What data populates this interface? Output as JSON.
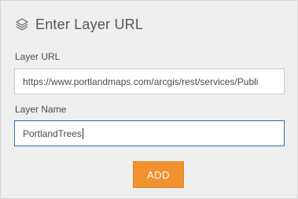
{
  "header": {
    "title": "Enter Layer URL",
    "icon": "layers-icon"
  },
  "form": {
    "url_label": "Layer URL",
    "url_value": "https://www.portlandmaps.com/arcgis/rest/services/Publi",
    "name_label": "Layer Name",
    "name_value": "PortlandTrees"
  },
  "actions": {
    "add_label": "ADD"
  },
  "colors": {
    "accent": "#f0922f",
    "panel_background": "#efefef",
    "focus_border": "#2c6db5"
  }
}
